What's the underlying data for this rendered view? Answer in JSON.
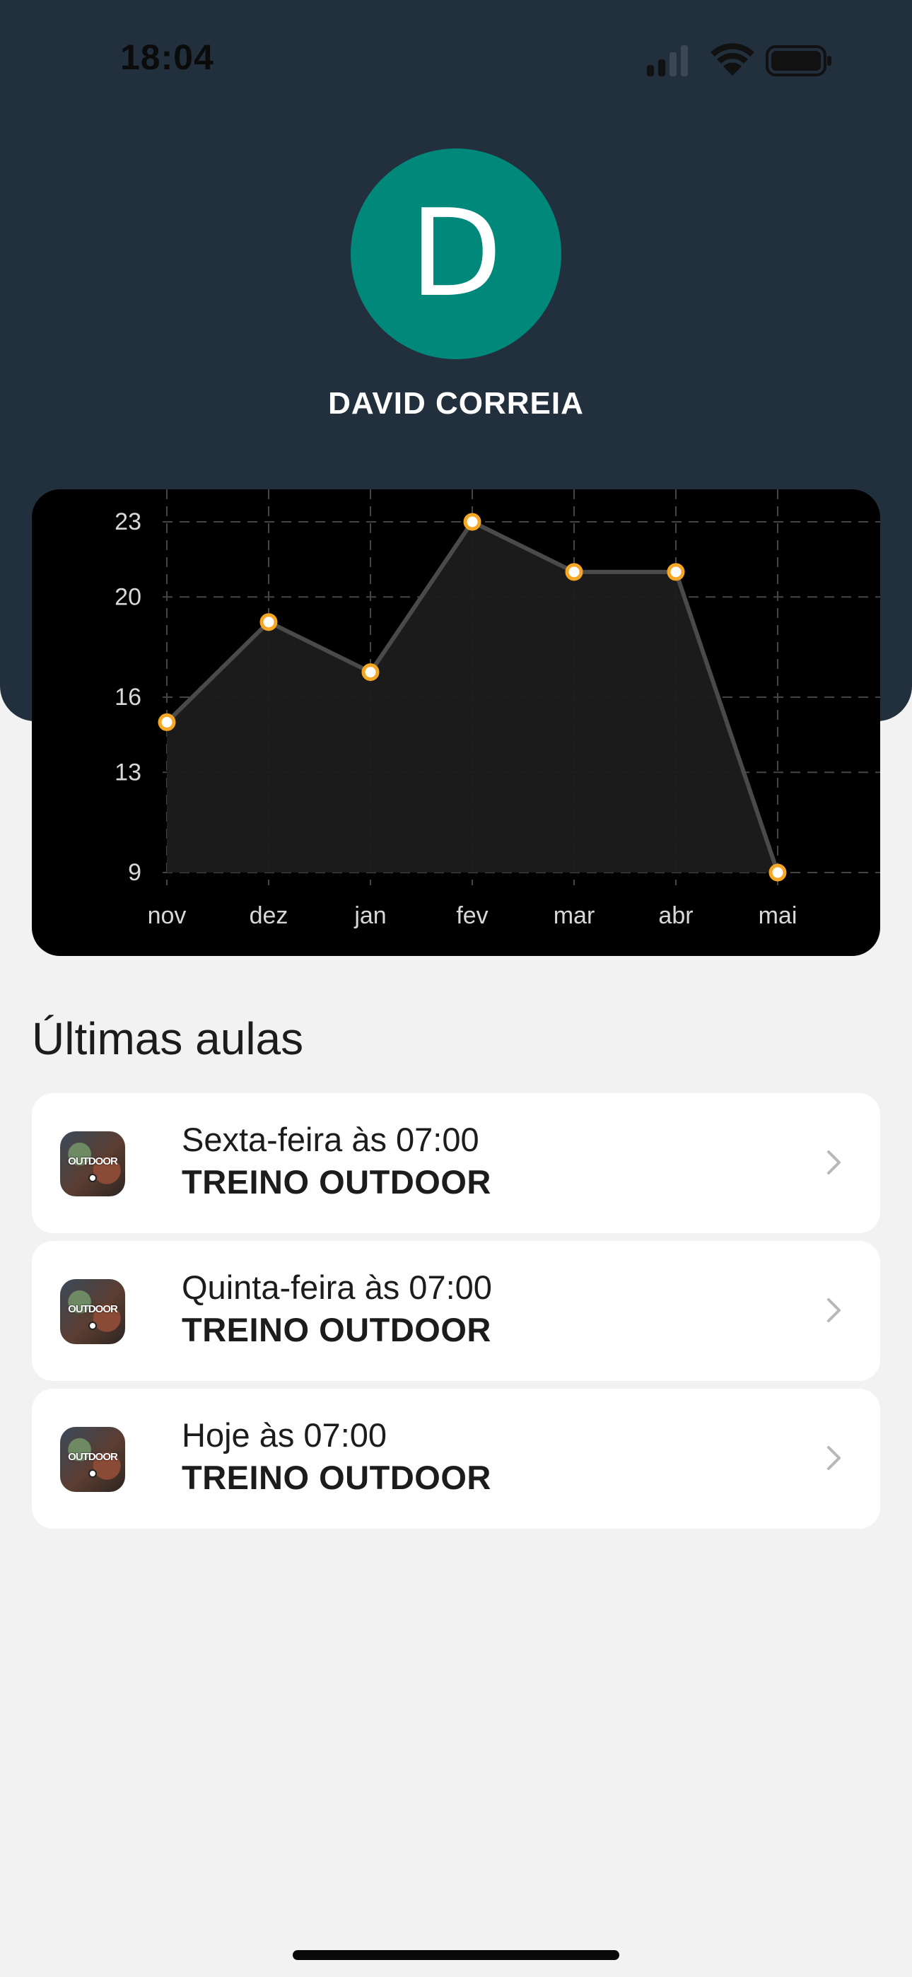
{
  "status_bar": {
    "time": "18:04"
  },
  "profile": {
    "initial": "D",
    "name": "DAVID CORREIA",
    "avatar_color": "#00897b"
  },
  "chart_data": {
    "type": "area",
    "categories": [
      "nov",
      "dez",
      "jan",
      "fev",
      "mar",
      "abr",
      "mai"
    ],
    "values": [
      15,
      19,
      17,
      23,
      21,
      21,
      9
    ],
    "y_ticks": [
      "23",
      "20",
      "16",
      "13",
      "9"
    ],
    "ylim": [
      9,
      23
    ],
    "grid": true,
    "line_color": "#4a4a4a",
    "point_color": "#f5a623",
    "fill_color": "#1c1c1c",
    "background": "#000000"
  },
  "section": {
    "title": "Últimas aulas"
  },
  "classes": [
    {
      "when": "Sexta-feira às 07:00",
      "name": "TREINO OUTDOOR",
      "thumb_label": "OUTDOOR"
    },
    {
      "when": "Quinta-feira às 07:00",
      "name": "TREINO OUTDOOR",
      "thumb_label": "OUTDOOR"
    },
    {
      "when": "Hoje às 07:00",
      "name": "TREINO OUTDOOR",
      "thumb_label": "OUTDOOR"
    }
  ],
  "colors": {
    "header": "#222f3d",
    "page": "#f2f2f2",
    "accent": "#f5a623"
  }
}
